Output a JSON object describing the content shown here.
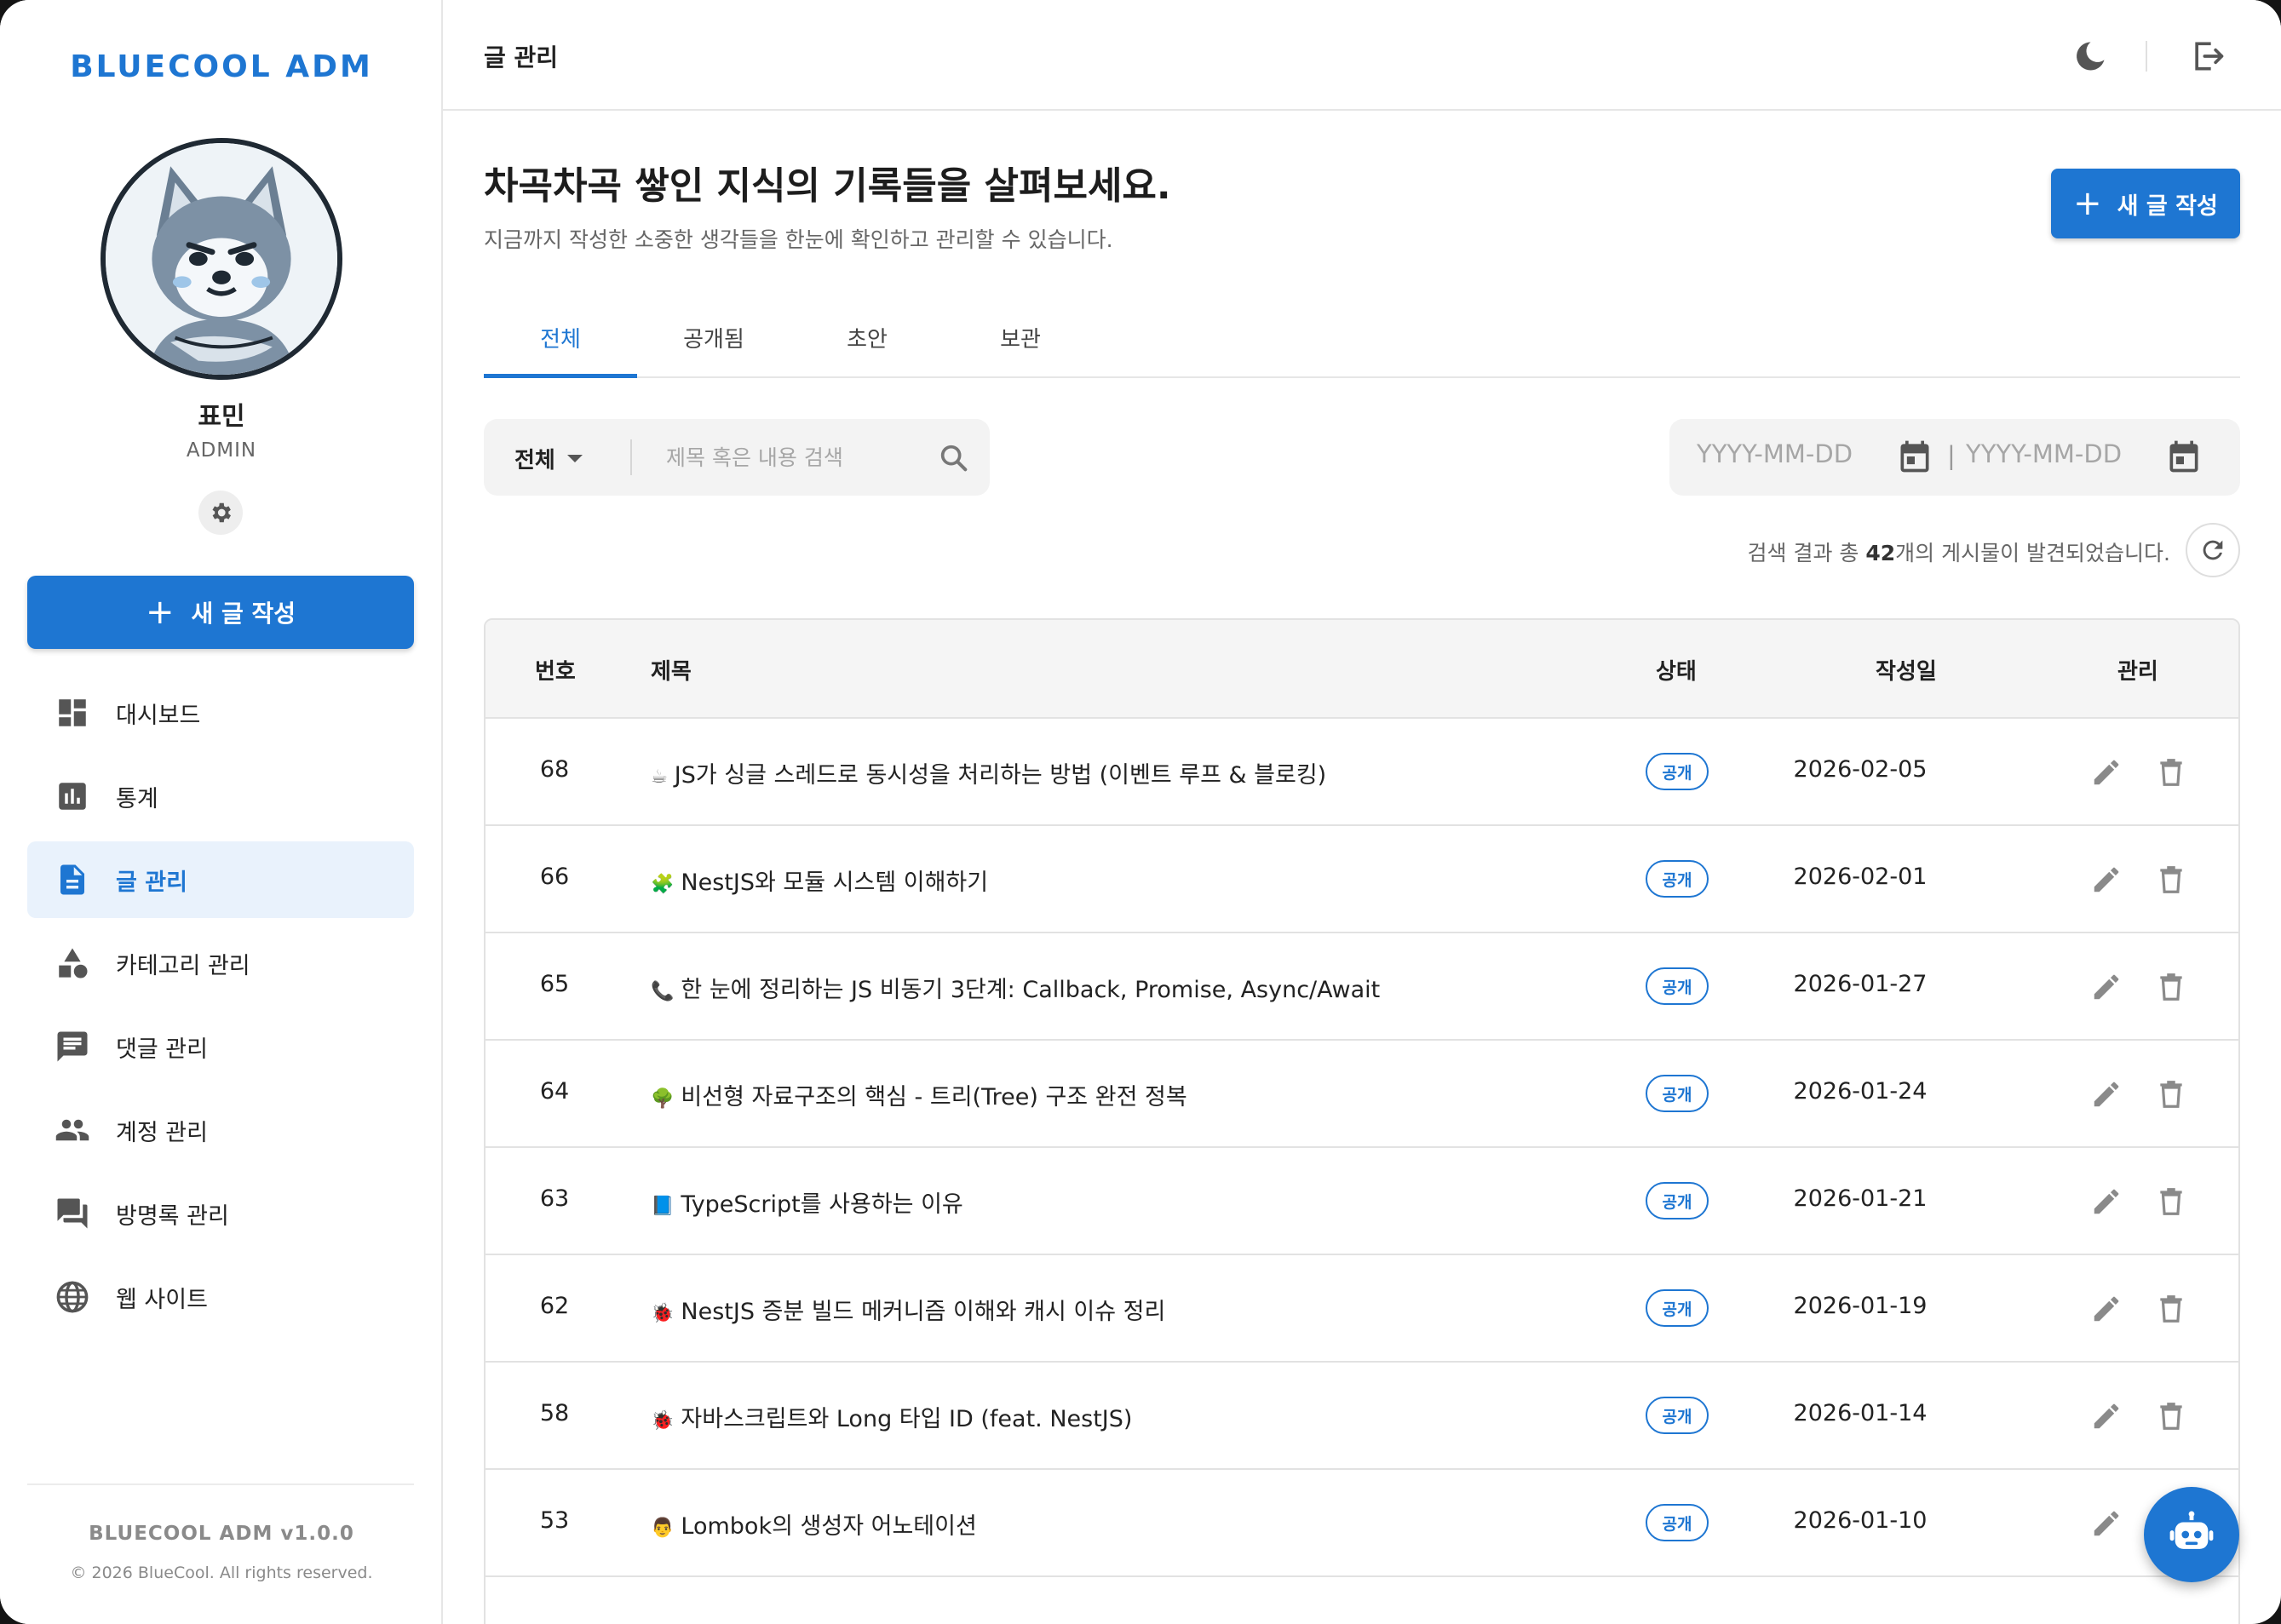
{
  "sidebar": {
    "brand": "BLUECOOL ADM",
    "profile": {
      "name": "표민",
      "role": "ADMIN"
    },
    "new_post_label": "새 글 작성",
    "nav": [
      {
        "label": "대시보드",
        "icon": "dashboard-icon"
      },
      {
        "label": "통계",
        "icon": "chart-icon"
      },
      {
        "label": "글 관리",
        "icon": "document-icon",
        "active": true
      },
      {
        "label": "카테고리 관리",
        "icon": "category-icon"
      },
      {
        "label": "댓글 관리",
        "icon": "comment-icon"
      },
      {
        "label": "계정 관리",
        "icon": "people-icon"
      },
      {
        "label": "방명록 관리",
        "icon": "forum-icon"
      },
      {
        "label": "웹 사이트",
        "icon": "globe-icon"
      }
    ],
    "version": "BLUECOOL ADM v1.0.0",
    "copyright": "© 2026 BlueCool. All rights reserved."
  },
  "topbar": {
    "title": "글 관리"
  },
  "content": {
    "title": "차곡차곡 쌓인 지식의 기록들을 살펴보세요.",
    "subtitle": "지금까지 작성한 소중한 생각들을 한눈에 확인하고 관리할 수 있습니다.",
    "new_post_label": "새 글 작성",
    "tabs": [
      {
        "label": "전체",
        "active": true
      },
      {
        "label": "공개됨"
      },
      {
        "label": "초안"
      },
      {
        "label": "보관"
      }
    ],
    "filter": {
      "selected": "전체"
    },
    "search": {
      "placeholder": "제목 혹은 내용 검색",
      "value": ""
    },
    "date_from_placeholder": "YYYY-MM-DD",
    "date_separator": "|",
    "date_to_placeholder": "YYYY-MM-DD",
    "result": {
      "prefix": "검색 결과 총 ",
      "count": "42",
      "suffix": "개의 게시물이 발견되었습니다."
    }
  },
  "table": {
    "headers": {
      "number": "번호",
      "title": "제목",
      "status": "상태",
      "date": "작성일",
      "actions": "관리"
    },
    "rows": [
      {
        "number": "68",
        "emoji": "☕",
        "title": "JS가 싱글 스레드로 동시성을 처리하는 방법 (이벤트 루프 & 블로킹)",
        "status": "공개",
        "date": "2026-02-05"
      },
      {
        "number": "66",
        "emoji": "🧩",
        "title": "NestJS와 모듈 시스템 이해하기",
        "status": "공개",
        "date": "2026-02-01"
      },
      {
        "number": "65",
        "emoji": "📞",
        "title": "한 눈에 정리하는 JS 비동기 3단계: Callback, Promise, Async/Await",
        "status": "공개",
        "date": "2026-01-27"
      },
      {
        "number": "64",
        "emoji": "🌳",
        "title": "비선형 자료구조의 핵심 - 트리(Tree) 구조 완전 정복",
        "status": "공개",
        "date": "2026-01-24"
      },
      {
        "number": "63",
        "emoji": "📘",
        "title": "TypeScript를 사용하는 이유",
        "status": "공개",
        "date": "2026-01-21"
      },
      {
        "number": "62",
        "emoji": "🐞",
        "title": "NestJS 증분 빌드 메커니즘 이해와 캐시 이슈 정리",
        "status": "공개",
        "date": "2026-01-19"
      },
      {
        "number": "58",
        "emoji": "🐞",
        "title": "자바스크립트와 Long 타입 ID (feat. NestJS)",
        "status": "공개",
        "date": "2026-01-14"
      },
      {
        "number": "53",
        "emoji": "👨",
        "title": "Lombok의 생성자 어노테이션",
        "status": "공개",
        "date": "2026-01-10"
      }
    ]
  },
  "colors": {
    "accent": "#1e76d2",
    "active_bg": "#e9f2fc",
    "border": "#e2e2e2"
  }
}
